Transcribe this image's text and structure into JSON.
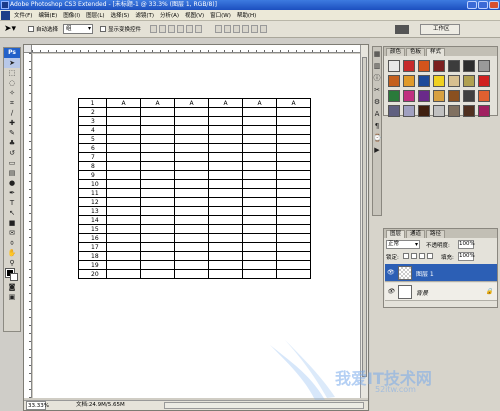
{
  "window": {
    "title": "Adobe Photoshop CS3 Extended - [未标题-1 @ 33.3% (图层 1, RGB/8)]"
  },
  "menu": [
    "文件(F)",
    "编辑(E)",
    "图像(I)",
    "图层(L)",
    "选择(S)",
    "滤镜(T)",
    "分析(A)",
    "视图(V)",
    "窗口(W)",
    "帮助(H)"
  ],
  "options": {
    "auto_select_label": "自动选择",
    "auto_select_value": "组",
    "show_transform_label": "显示变换控件",
    "workspace_label": "工作区"
  },
  "tools": [
    "移动",
    "选框",
    "套索",
    "魔棒",
    "裁剪",
    "切片",
    "修复",
    "画笔",
    "图章",
    "历史",
    "橡皮",
    "渐变",
    "减淡",
    "钢笔",
    "文字",
    "路径",
    "形状",
    "注释",
    "吸管",
    "抓手",
    "缩放"
  ],
  "document": {
    "zoom": "33.33%",
    "info": "文档:24.9M/5.65M"
  },
  "sheet": {
    "header": [
      "1",
      "A",
      "A",
      "A",
      "A",
      "A",
      "A"
    ],
    "rows": [
      "2",
      "3",
      "4",
      "5",
      "6",
      "7",
      "8",
      "9",
      "10",
      "11",
      "12",
      "13",
      "14",
      "15",
      "16",
      "17",
      "18",
      "19",
      "20"
    ]
  },
  "swatch_panel": {
    "tabs": [
      "颜色",
      "色板",
      "样式"
    ],
    "swatch_colors": [
      "#e8e8e8",
      "#c62a2a",
      "#d4541c",
      "#7b1f1f",
      "#3c3c3c",
      "#2d2d2d",
      "#9a9a9a",
      "#c4601e",
      "#e09a2a",
      "#1d4a9a",
      "#f0d020",
      "#d8c090",
      "#b0a050",
      "#d02020",
      "#2a7a3a",
      "#c03080",
      "#6a2a8a",
      "#d8a040",
      "#8a5020",
      "#404040",
      "#e06030",
      "#606080",
      "#a0a0c0",
      "#402010",
      "#c0c0c0",
      "#807060",
      "#503020",
      "#a02060"
    ]
  },
  "layers_panel": {
    "tabs": [
      "图层",
      "通道",
      "路径"
    ],
    "blend_mode": "正常",
    "opacity_label": "不透明度:",
    "opacity_value": "100%",
    "lock_label": "锁定:",
    "fill_label": "填充:",
    "fill_value": "100%",
    "layers": [
      {
        "name": "图层 1",
        "selected": true
      },
      {
        "name": "背景",
        "selected": false
      }
    ]
  },
  "watermark": {
    "text": "我爱IT技术网",
    "sub": "52itw.com"
  }
}
